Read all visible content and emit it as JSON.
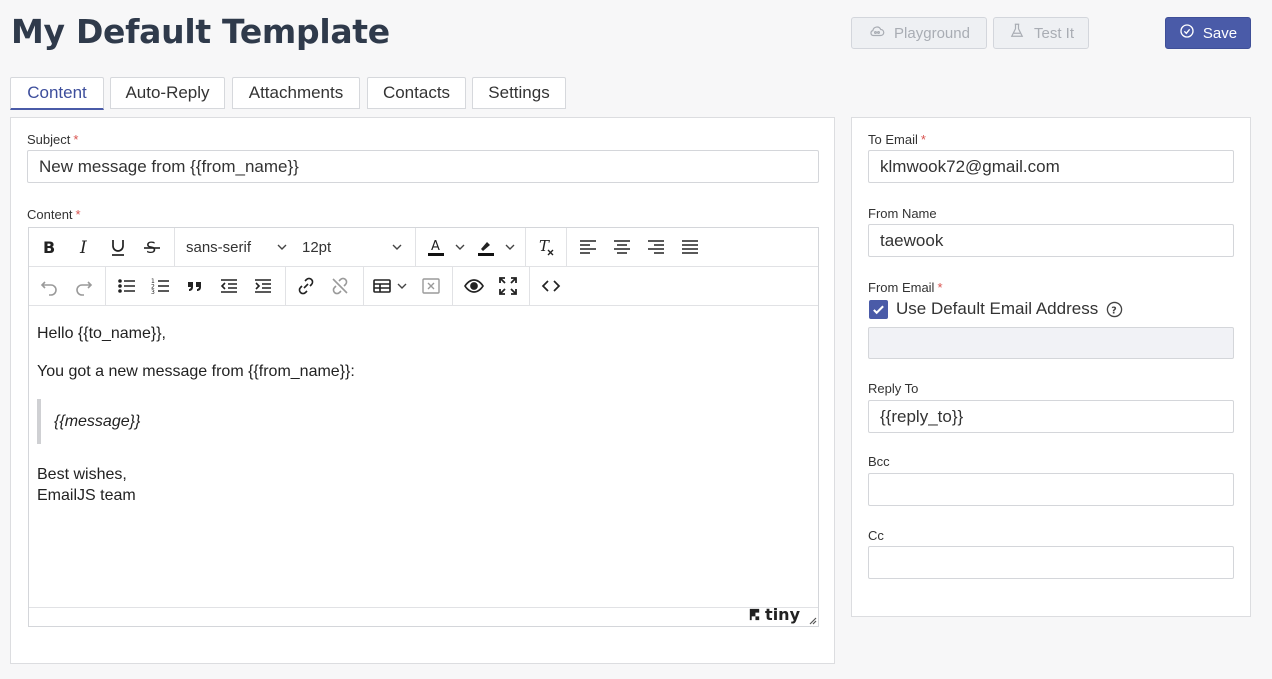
{
  "header": {
    "title": "My Default Template",
    "playground_label": "Playground",
    "test_label": "Test It",
    "save_label": "Save"
  },
  "tabs": [
    {
      "label": "Content",
      "active": true
    },
    {
      "label": "Auto-Reply",
      "active": false
    },
    {
      "label": "Attachments",
      "active": false
    },
    {
      "label": "Contacts",
      "active": false
    },
    {
      "label": "Settings",
      "active": false
    }
  ],
  "content": {
    "subject_label": "Subject",
    "subject_value": "New message from {{from_name}}",
    "content_label": "Content",
    "toolbar": {
      "font_family": "sans-serif",
      "font_size": "12pt"
    },
    "body": {
      "greeting": "Hello {{to_name}},",
      "line1": "You got a new message from {{from_name}}:",
      "quote": "{{message}}",
      "closing1": "Best wishes,",
      "closing2": "EmailJS team"
    },
    "brand": "tiny"
  },
  "sidebar": {
    "to_email_label": "To Email",
    "to_email_value": "klmwook72@gmail.com",
    "from_name_label": "From Name",
    "from_name_value": "taewook",
    "from_email_label": "From Email",
    "use_default_label": "Use Default Email Address",
    "use_default_checked": true,
    "from_email_value": "",
    "reply_to_label": "Reply To",
    "reply_to_value": "{{reply_to}}",
    "bcc_label": "Bcc",
    "bcc_value": "",
    "cc_label": "Cc",
    "cc_value": ""
  },
  "colors": {
    "accent": "#4a5ba8",
    "required": "#d9534f",
    "title": "#2f3a4b"
  }
}
